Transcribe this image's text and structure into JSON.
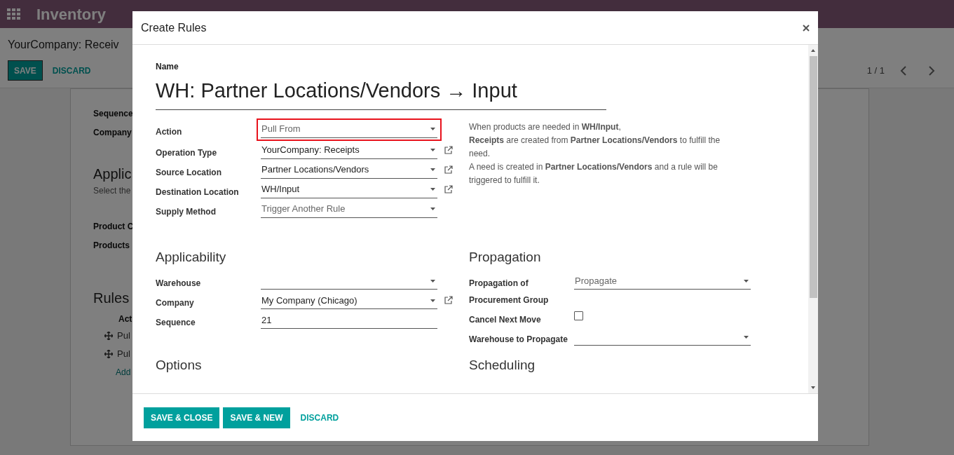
{
  "app": {
    "title": "Inventory"
  },
  "control_panel": {
    "breadcrumb": "YourCompany: Receiv",
    "buttons": [
      {
        "label": "SAVE",
        "kind": "primary"
      },
      {
        "label": "DISCARD",
        "kind": "link"
      }
    ],
    "pager": "1 / 1"
  },
  "sheet": {
    "labels": [
      {
        "text": "Sequence",
        "kind": "label"
      },
      {
        "text": "Company",
        "kind": "label"
      },
      {
        "text": "Applic",
        "kind": "heading"
      },
      {
        "text": "Select the",
        "kind": "hint"
      },
      {
        "text": "Product C",
        "kind": "label"
      },
      {
        "text": "Products",
        "kind": "label"
      }
    ],
    "rules": {
      "title": "Rules",
      "column": "Act",
      "rows": [
        "Pul",
        "Pul"
      ],
      "add": "Add"
    }
  },
  "dialog": {
    "title": "Create Rules",
    "name_label": "Name",
    "name": "WH: Partner Locations/Vendors → Input",
    "fields": [
      {
        "label": "Action",
        "kind": "select",
        "value": "Pull From",
        "muted": true,
        "external_link": false,
        "highlighted": true
      },
      {
        "label": "Operation Type",
        "kind": "select",
        "value": "YourCompany: Receipts",
        "muted": false,
        "external_link": true,
        "highlighted": false
      },
      {
        "label": "Source Location",
        "kind": "select",
        "value": "Partner Locations/Vendors",
        "muted": false,
        "external_link": true,
        "highlighted": false
      },
      {
        "label": "Destination Location",
        "kind": "select",
        "value": "WH/Input",
        "muted": false,
        "external_link": true,
        "highlighted": false
      },
      {
        "label": "Supply Method",
        "kind": "select",
        "value": "Trigger Another Rule",
        "muted": true,
        "external_link": false,
        "highlighted": false
      }
    ],
    "help": [
      "When products are needed in **WH/Input**,",
      "**Receipts** are created from **Partner Locations/Vendors** to fulfill the need.",
      "A need is created in **Partner Locations/Vendors** and a rule will be triggered to fulfill it."
    ],
    "sections": [
      {
        "title": "Applicability",
        "fields": [
          {
            "label": "Warehouse",
            "kind": "select",
            "external_link": false,
            "highlighted": false
          },
          {
            "label": "Company",
            "kind": "select",
            "value": "My Company (Chicago)",
            "muted": false,
            "external_link": true,
            "highlighted": false
          },
          {
            "label": "Sequence",
            "kind": "text",
            "value": "21",
            "muted": false,
            "external_link": false,
            "highlighted": false
          }
        ]
      },
      {
        "title": "Propagation",
        "fields": [
          {
            "label": "Propagation of Procurement Group",
            "kind": "select",
            "value": "Propagate",
            "muted": true,
            "external_link": false,
            "highlighted": false
          },
          {
            "label": "Cancel Next Move",
            "kind": "checkbox",
            "checked": false
          },
          {
            "label": "Warehouse to Propagate",
            "kind": "select",
            "external_link": false,
            "highlighted": false
          }
        ]
      },
      {
        "title": "Options"
      },
      {
        "title": "Scheduling"
      }
    ],
    "buttons": [
      {
        "label": "SAVE & CLOSE",
        "kind": "primary"
      },
      {
        "label": "SAVE & NEW",
        "kind": "primary"
      },
      {
        "label": "DISCARD",
        "kind": "link"
      }
    ]
  }
}
